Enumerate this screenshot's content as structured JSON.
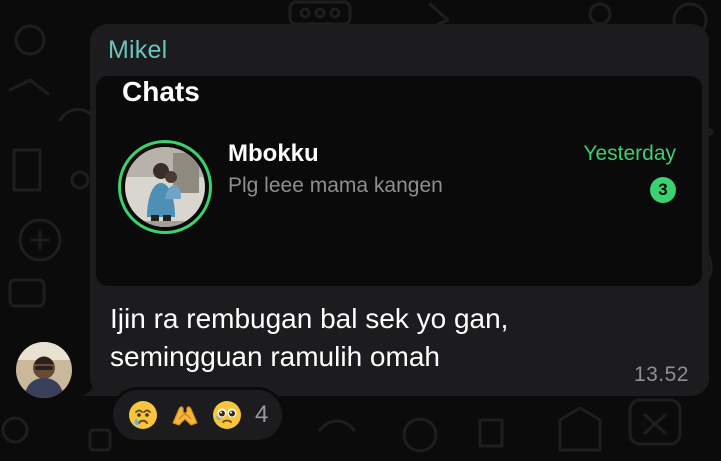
{
  "message": {
    "sender_name": "Mikel",
    "text_line1": "Ijin ra rembugan bal sek yo gan,",
    "text_line2": "semingguan ramulih omah",
    "time": "13.52"
  },
  "screenshot": {
    "title": "Chats",
    "chat_name": "Mbokku",
    "chat_preview": "Plg leee mama kangen",
    "chat_time": "Yesterday",
    "unread_count": "3"
  },
  "reactions": {
    "emojis": [
      "crying-face",
      "heart-hands",
      "face-holding-back-tears"
    ],
    "count": "4"
  },
  "colors": {
    "sender_name": "#6cc3bd",
    "accent_green": "#3bd16f",
    "bubble": "#1c1c1e",
    "background": "#0b0b0b"
  }
}
